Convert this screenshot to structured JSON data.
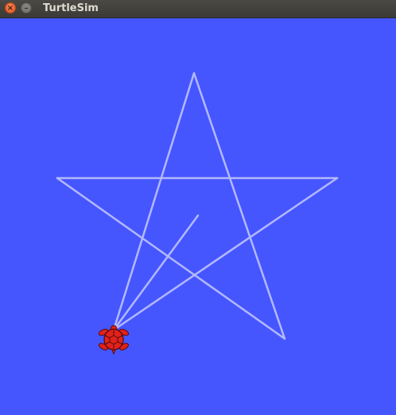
{
  "window": {
    "title": "TurtleSim",
    "close_icon_glyph": "×",
    "minimize_icon_glyph": "–"
  },
  "canvas": {
    "background_color": "#4556ff",
    "pen_color": "#b3b8ff",
    "turtle_color": "#e0221c"
  }
}
